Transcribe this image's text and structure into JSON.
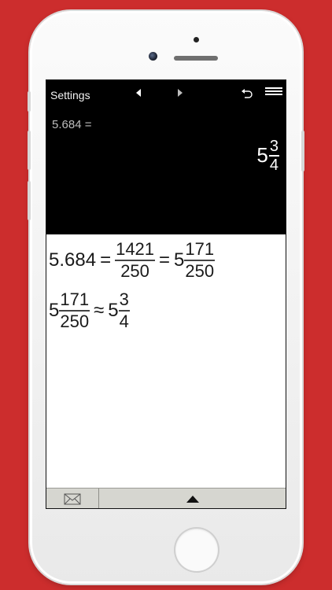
{
  "colors": {
    "background": "#cc2d2d",
    "screen_black": "#000000",
    "work_area": "#ffffff",
    "bottom_bar": "#d6d6d0"
  },
  "topbar": {
    "settings_label": "Settings",
    "icons": [
      "back-arrow-icon",
      "forward-arrow-icon",
      "undo-icon",
      "menu-icon"
    ]
  },
  "display": {
    "expression": "5.684 =",
    "result": {
      "whole": "5",
      "numerator": "3",
      "denominator": "4"
    }
  },
  "work": {
    "line1": {
      "decimal": "5.684",
      "eq1": "=",
      "improper": {
        "numerator": "1421",
        "denominator": "250"
      },
      "eq2": "=",
      "mixed": {
        "whole": "5",
        "numerator": "171",
        "denominator": "250"
      }
    },
    "line2": {
      "mixed": {
        "whole": "5",
        "numerator": "171",
        "denominator": "250"
      },
      "approx": "≈",
      "approx_mixed": {
        "whole": "5",
        "numerator": "3",
        "denominator": "4"
      }
    }
  },
  "bottombar": {
    "icons": [
      "mail-icon",
      "expand-up-icon"
    ]
  }
}
